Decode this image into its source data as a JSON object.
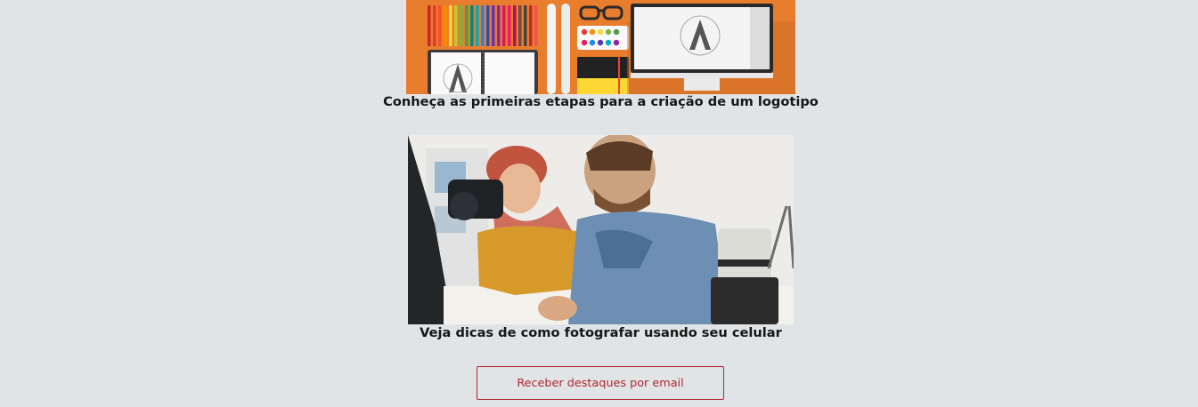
{
  "articles": [
    {
      "title": "Conheça as primeiras etapas para a criação de um logotipo",
      "image": "design-tools-illustration"
    },
    {
      "title": "Veja dicas de como fotografar usando seu celular",
      "image": "photographers-photo"
    }
  ],
  "newsletter": {
    "button_label": "Receber destaques por email"
  },
  "colors": {
    "page_bg": "#e1e4e6",
    "accent": "#b0262c",
    "illustration_bg": "#e87d2e"
  }
}
